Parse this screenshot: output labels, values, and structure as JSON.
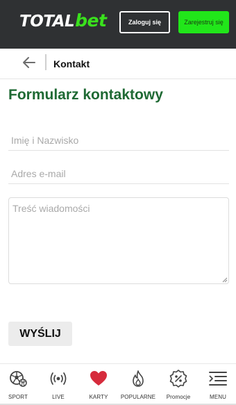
{
  "header": {
    "logo_total": "TOTAL",
    "logo_bet": "bet",
    "login_label": "Zaloguj się",
    "register_label": "Zarejestruj się"
  },
  "subnav": {
    "title": "Kontakt"
  },
  "form": {
    "title": "Formularz kontaktowy",
    "name_placeholder": "Imię i Nazwisko",
    "email_placeholder": "Adres e-mail",
    "message_placeholder": "Treść wiadomości",
    "submit_label": "WYŚLIJ"
  },
  "bottom_nav": {
    "items": [
      {
        "label": "SPORT",
        "icon": "soccer-ball-icon"
      },
      {
        "label": "LIVE",
        "icon": "live-broadcast-icon"
      },
      {
        "label": "KARTY",
        "icon": "heart-icon"
      },
      {
        "label": "POPULARNE",
        "icon": "flame-icon"
      },
      {
        "label": "Promocje",
        "icon": "percent-badge-icon"
      },
      {
        "label": "MENU",
        "icon": "menu-icon"
      }
    ]
  },
  "colors": {
    "header_bg": "#2f3133",
    "brand_green": "#3ae11d",
    "register_bg": "#21e61a",
    "title_green": "#1f6a34",
    "heart_red": "#d62b3c"
  }
}
